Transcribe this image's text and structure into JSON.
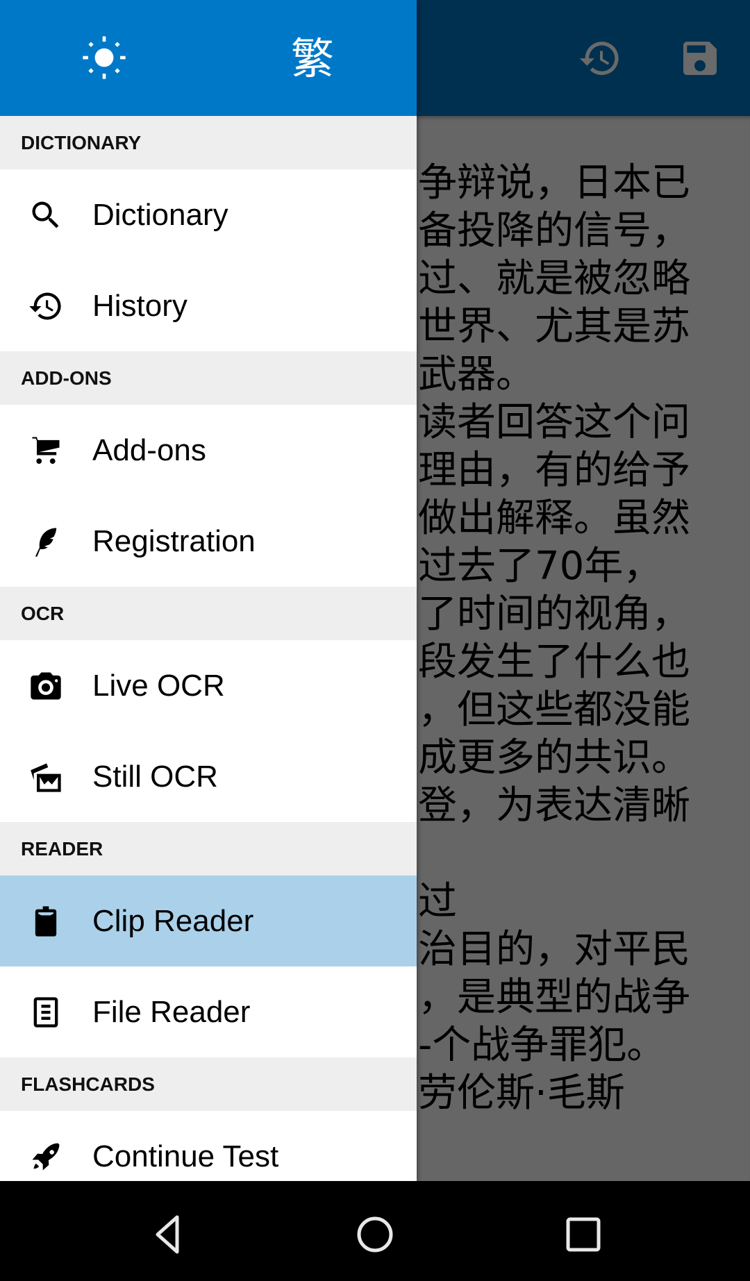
{
  "app_toolbar": {
    "actions": [
      {
        "icon": "history-icon",
        "label": "History"
      },
      {
        "icon": "save-icon",
        "label": "Save"
      }
    ]
  },
  "drawer": {
    "header": {
      "theme_icon": "brightness-icon",
      "script_toggle": "繁"
    },
    "sections": [
      {
        "title": "DICTIONARY",
        "items": [
          {
            "label": "Dictionary",
            "icon": "search-icon"
          },
          {
            "label": "History",
            "icon": "history-icon"
          }
        ]
      },
      {
        "title": "ADD-ONS",
        "items": [
          {
            "label": "Add-ons",
            "icon": "cart-icon"
          },
          {
            "label": "Registration",
            "icon": "feather-icon"
          }
        ]
      },
      {
        "title": "OCR",
        "items": [
          {
            "label": "Live OCR",
            "icon": "camera-icon"
          },
          {
            "label": "Still OCR",
            "icon": "photos-icon"
          }
        ]
      },
      {
        "title": "READER",
        "items": [
          {
            "label": "Clip Reader",
            "icon": "clipboard-icon",
            "selected": true
          },
          {
            "label": "File Reader",
            "icon": "document-icon"
          }
        ]
      },
      {
        "title": "FLASHCARDS",
        "items": [
          {
            "label": "Continue Test",
            "icon": "rocket-icon"
          }
        ]
      }
    ]
  },
  "reader": {
    "lines": [
      "争辩说，日本已",
      "备投降的信号，",
      "过、就是被忽略",
      "世界、尤其是苏",
      "武器。",
      "读者回答这个问",
      "理由，有的给予",
      "做出解释。虽然",
      "过去了70年，",
      "了时间的视角，",
      "段发生了什么也",
      "，但这些都没能",
      "成更多的共识。",
      "登，为表达清晰",
      "",
      "过",
      "治目的，对平民",
      "，是典型的战争",
      "-个战争罪犯。",
      "劳伦斯·毛斯"
    ]
  },
  "nav_bar": {
    "buttons": [
      "back",
      "home",
      "recents"
    ]
  },
  "colors": {
    "drawer_header": "#0078c8",
    "toolbar_dimmed": "#00304f",
    "content_dimmed": "#666666",
    "section_header_bg": "#eeeeee",
    "selected_item_bg": "#abd1ea",
    "nav_bar": "#000000"
  }
}
